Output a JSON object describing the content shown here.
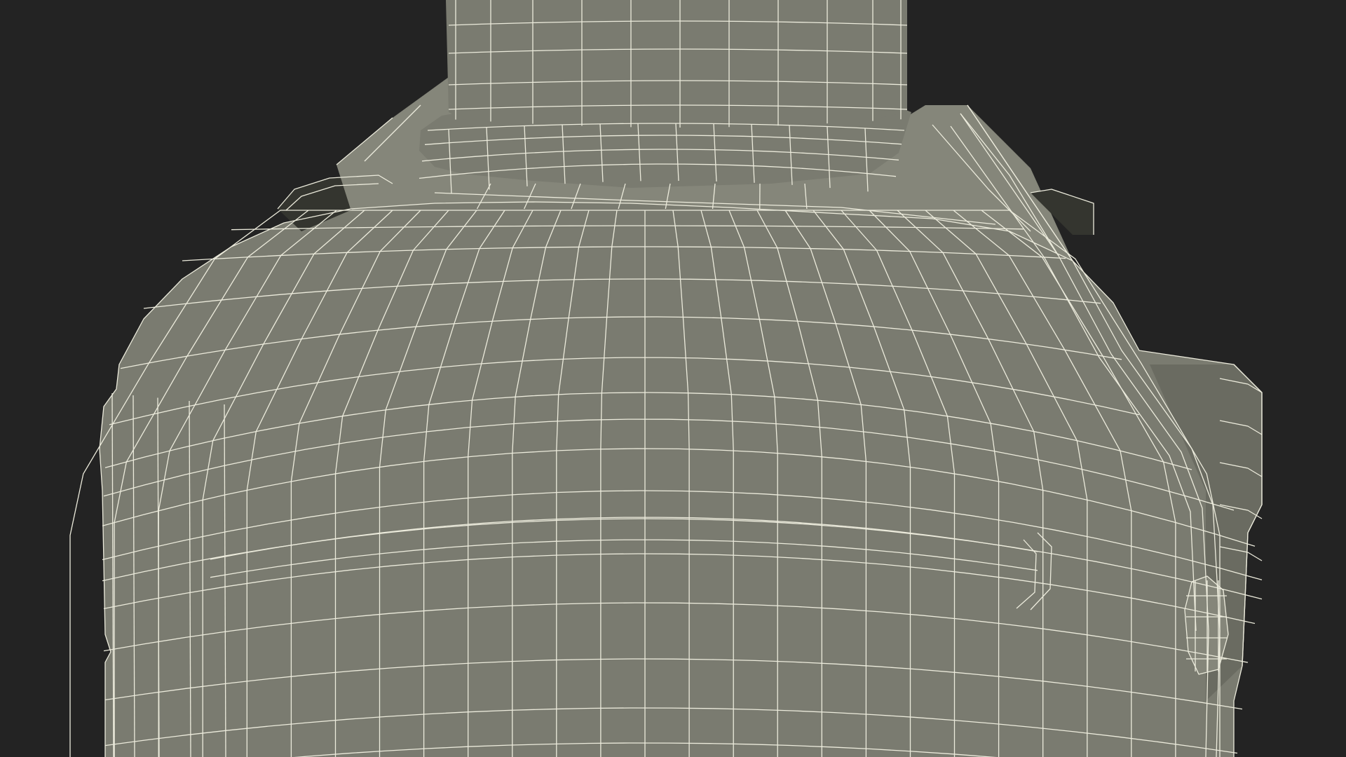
{
  "scene": {
    "subject": "wireframe-mesh-render",
    "colors": {
      "background": "#232323",
      "surface": "#7a7b70",
      "surface_light": "#85867a",
      "surface_dark": "#6a6b61",
      "interior": "#34352f",
      "wire": "#ecebdc"
    }
  }
}
